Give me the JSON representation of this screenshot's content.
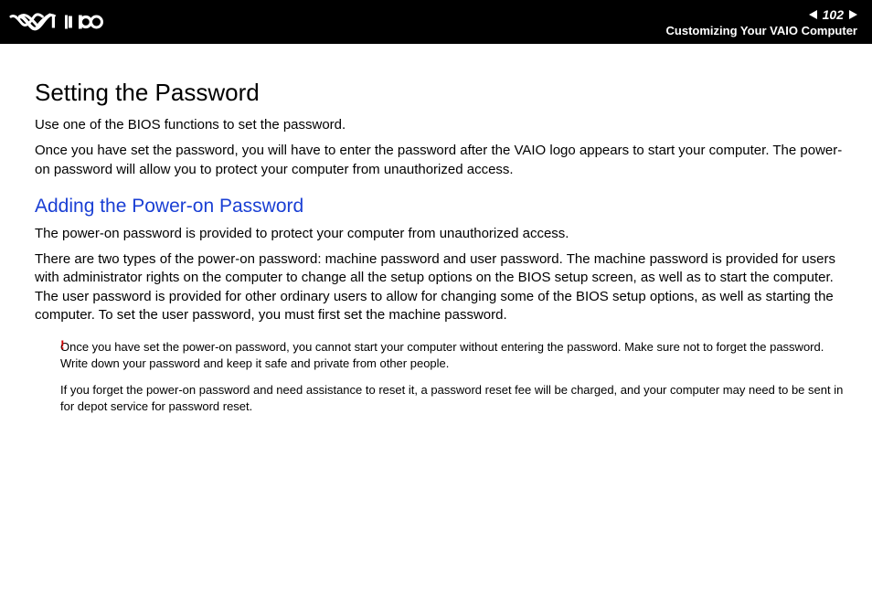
{
  "header": {
    "page_number": "102",
    "section": "Customizing Your VAIO Computer"
  },
  "content": {
    "main_heading": "Setting the Password",
    "intro_1": "Use one of the BIOS functions to set the password.",
    "intro_2": "Once you have set the password, you will have to enter the password after the VAIO logo appears to start your computer. The power-on password will allow you to protect your computer from unauthorized access.",
    "sub_heading": "Adding the Power-on Password",
    "para_1": "The power-on password is provided to protect your computer from unauthorized access.",
    "para_2": "There are two types of the power-on password: machine password and user password. The machine password is provided for users with administrator rights on the computer to change all the setup options on the BIOS setup screen, as well as to start the computer. The user password is provided for other ordinary users to allow for changing some of the BIOS setup options, as well as starting the computer. To set the user password, you must first set the machine password.",
    "note_marker": "!",
    "note_1": "Once you have set the power-on password, you cannot start your computer without entering the password. Make sure not to forget the password. Write down your password and keep it safe and private from other people.",
    "note_2": "If you forget the power-on password and need assistance to reset it, a password reset fee will be charged, and your computer may need to be sent in for depot service for password reset."
  }
}
